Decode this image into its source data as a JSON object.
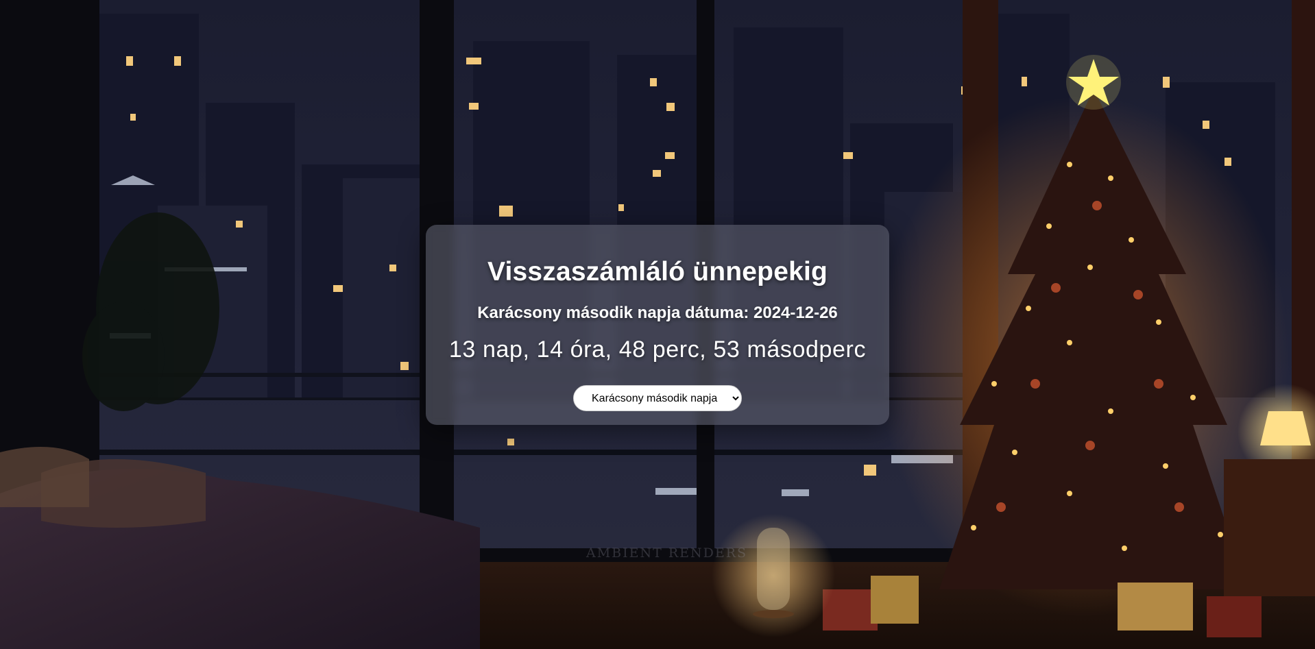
{
  "countdown": {
    "title": "Visszaszámláló ünnepekig",
    "date_line": "Karácsony második napja dátuma: 2024-12-26",
    "remaining": "13 nap, 14 óra, 48 perc, 53 másodperc",
    "holiday_select": {
      "selected": "Karácsony második napja"
    }
  },
  "background": {
    "watermark": "AMBIENT RENDERS",
    "colors": {
      "night_sky": "#1a1c2e",
      "window_frame": "#0b0b10",
      "warm_light": "#ffd27a",
      "tree_green": "#2a1a10",
      "panel_bg": "rgba(92,94,108,0.62)"
    }
  }
}
